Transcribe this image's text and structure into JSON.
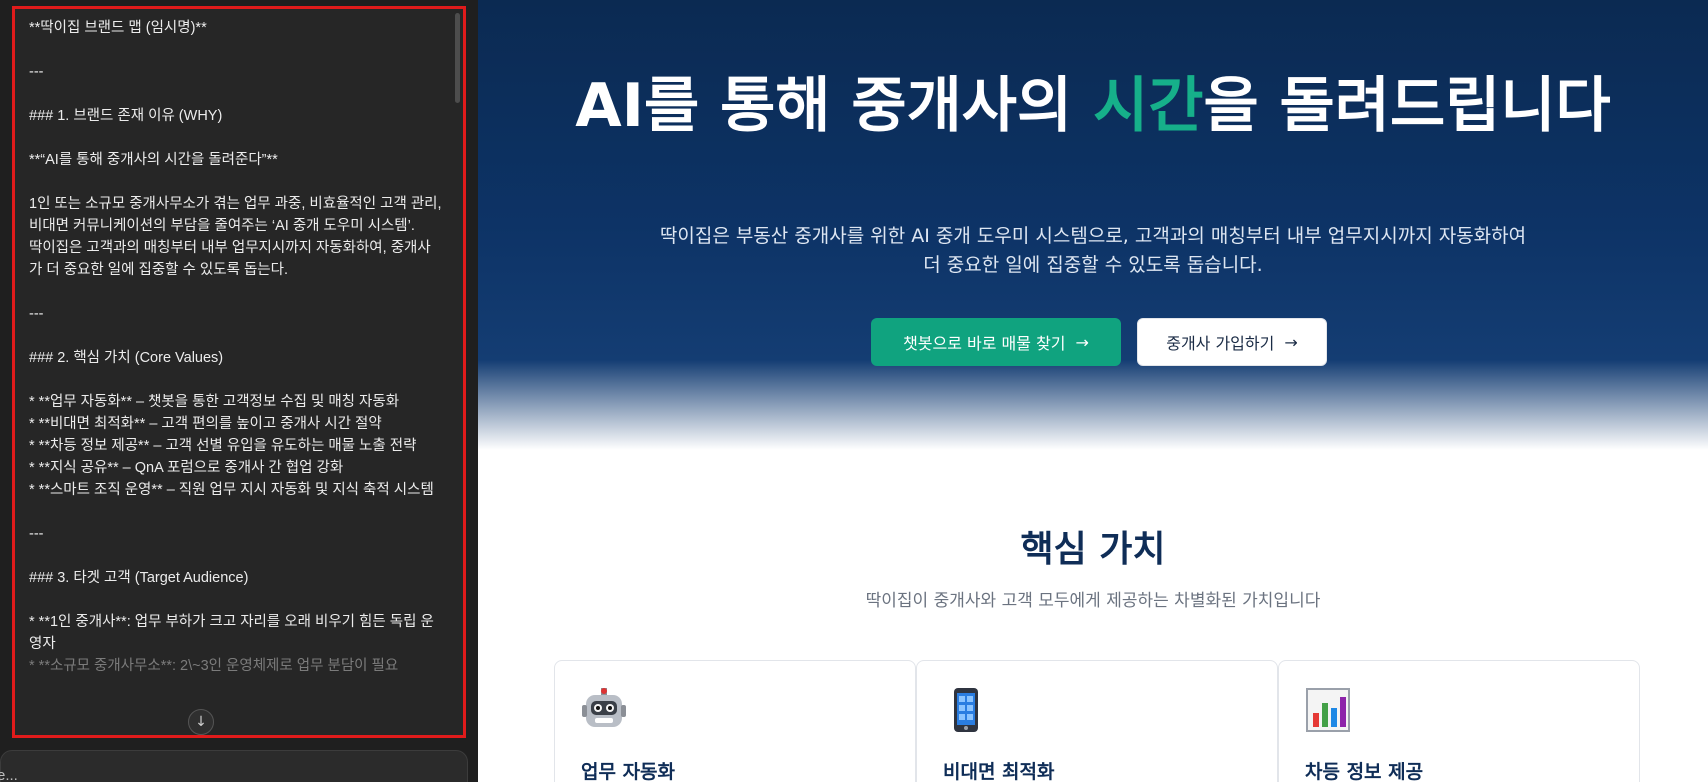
{
  "editor": {
    "lines": [
      "**딱이집 브랜드 맵 (임시명)**",
      "",
      "---",
      "",
      "### 1. 브랜드 존재 이유 (WHY)",
      "",
      "**“AI를 통해 중개사의 시간을 돌려준다”**",
      "",
      "1인 또는 소규모 중개사무소가 겪는 업무 과중, 비효율적인 고객 관리, 비대면 커뮤니케이션의 부담을 줄여주는 ‘AI 중개 도우미 시스템’.",
      "딱이집은 고객과의 매칭부터 내부 업무지시까지 자동화하여, 중개사가 더 중요한 일에 집중할 수 있도록 돕는다.",
      "",
      "---",
      "",
      "### 2. 핵심 가치 (Core Values)",
      "",
      "* **업무 자동화** – 챗봇을 통한 고객정보 수집 및 매칭 자동화",
      "* **비대면 최적화** – 고객 편의를 높이고 중개사 시간 절약",
      "* **차등 정보 제공** – 고객 선별 유입을 유도하는 매물 노출 전략",
      "* **지식 공유** – QnA 포럼으로 중개사 간 협업 강화",
      "* **스마트 조직 운영** – 직원 업무 지시 자동화 및 지식 축적 시스템",
      "",
      "---",
      "",
      "### 3. 타겟 고객 (Target Audience)",
      "",
      "* **1인 중개사**: 업무 부하가 크고 자리를 오래 비우기 힘든 독립 운영자",
      "* **소규모 중개사무소**: 2\\~3인 운영체제로 업무 분담이 필요"
    ],
    "scroll_down_icon": "arrow-down-icon",
    "chat_input_text": "e..."
  },
  "hero": {
    "title_before": "AI를 통해 중개사의 ",
    "title_accent": "시간",
    "title_after": "을 돌려드립니다",
    "subtitle": "딱이집은 부동산 중개사를 위한 AI 중개 도우미 시스템으로, 고객과의 매칭부터 내부 업무지시까지 자동화하여 더 중요한 일에 집중할 수 있도록 돕습니다.",
    "primary_button": "챗봇으로 바로 매물 찾기",
    "secondary_button": "중개사 가입하기",
    "accent_color": "#16b08a",
    "background_color": "#0d3366"
  },
  "values": {
    "title": "핵심 가치",
    "subtitle": "딱이집이 중개사와 고객 모두에게 제공하는 차별화된 가치입니다",
    "cards": [
      {
        "title": "업무 자동화",
        "icon": "robot-icon"
      },
      {
        "title": "비대면 최적화",
        "icon": "mobile-phone-icon"
      },
      {
        "title": "차등 정보 제공",
        "icon": "bar-chart-icon"
      }
    ]
  }
}
